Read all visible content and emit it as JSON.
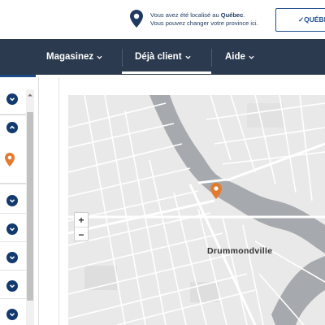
{
  "location_banner": {
    "line1_prefix": "Vous avez été localisé au ",
    "province": "Québec",
    "line1_suffix": ".",
    "line2": "Vous pouvez changer votre province ici.",
    "confirm_label": "✓QUÉBEC"
  },
  "nav": {
    "items": [
      {
        "label": "Magasinez"
      },
      {
        "label": "Déjà client"
      },
      {
        "label": "Aide"
      }
    ],
    "active": "Déjà client"
  },
  "map": {
    "city_label": "Drummondville",
    "zoom_in": "+",
    "zoom_out": "−"
  },
  "colors": {
    "nav_bg": "#2b3a4e",
    "brand_blue": "#123a6e",
    "pin_orange": "#e47a2e"
  }
}
